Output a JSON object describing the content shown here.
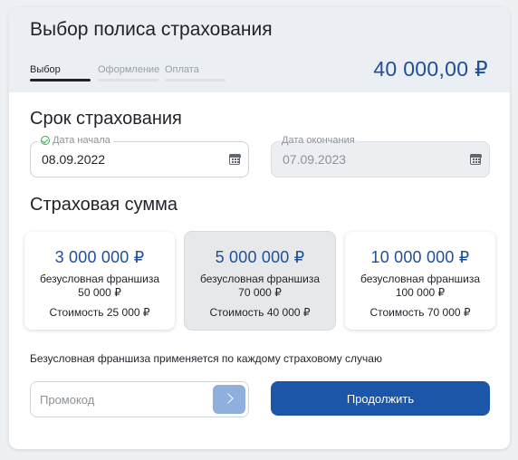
{
  "header": {
    "title": "Выбор полиса страхования",
    "price": "40 000,00 ₽",
    "steps": [
      {
        "label": "Выбор",
        "active": true
      },
      {
        "label": "Оформление",
        "active": false
      },
      {
        "label": "Оплата",
        "active": false
      }
    ]
  },
  "term": {
    "title": "Срок страхования",
    "start": {
      "label": "Дата начала",
      "value": "08.09.2022"
    },
    "end": {
      "label": "Дата окончания",
      "value": "07.09.2023"
    }
  },
  "sum": {
    "title": "Страховая сумма",
    "options": [
      {
        "amount": "3 000 000 ₽",
        "franchise_label": "безусловная франшиза",
        "franchise_value": "50 000 ₽",
        "cost": "Стоимость 25 000 ₽",
        "selected": false
      },
      {
        "amount": "5 000 000 ₽",
        "franchise_label": "безусловная франшиза",
        "franchise_value": "70 000 ₽",
        "cost": "Стоимость 40 000 ₽",
        "selected": true
      },
      {
        "amount": "10 000 000 ₽",
        "franchise_label": "безусловная франшиза",
        "franchise_value": "100 000 ₽",
        "cost": "Стоимость 70 000 ₽",
        "selected": false
      }
    ]
  },
  "note": "Безусловная франшиза применяется по каждому страховому случаю",
  "promo": {
    "placeholder": "Промокод",
    "value": ""
  },
  "continue_label": "Продолжить",
  "colors": {
    "accent": "#1b56a9",
    "price": "#1e4f9a",
    "success": "#3aa757"
  }
}
